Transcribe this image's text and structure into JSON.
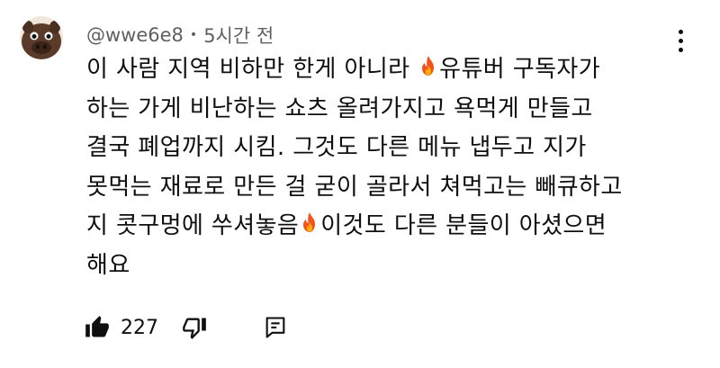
{
  "comment": {
    "author": "@wwe6e8",
    "separator": "•",
    "time": "5시간 전",
    "lines": [
      [
        "이 사람 지역 비하만 한게 아니라 ",
        "fire",
        "유튜버 구독자가"
      ],
      [
        "하는 가게 비난하는 쇼츠 올려가지고 욕먹게 만들고"
      ],
      [
        "결국 폐업까지 시킴. 그것도 다른 메뉴 냅두고 지가"
      ],
      [
        "못먹는 재료로 만든 걸 굳이 골라서 쳐먹고는 빼큐하고"
      ],
      [
        "지 콧구멍에 쑤셔놓음",
        "fire",
        "이것도 다른 분들이 아셨으면"
      ],
      [
        "해요"
      ]
    ],
    "like_count": "227"
  },
  "icons": {
    "avatar": "avatar-brown-cartoon",
    "menu": "more-vertical-icon",
    "like": "thumbs-up-icon",
    "dislike": "thumbs-down-icon",
    "reply": "reply-comment-icon",
    "emoji": "fire-emoji"
  },
  "colors": {
    "text": "#0f0f0f",
    "meta": "#606060",
    "avatar_bg": "#5a3a28",
    "fire_outer": "#f4511e",
    "fire_inner": "#ffb300"
  }
}
